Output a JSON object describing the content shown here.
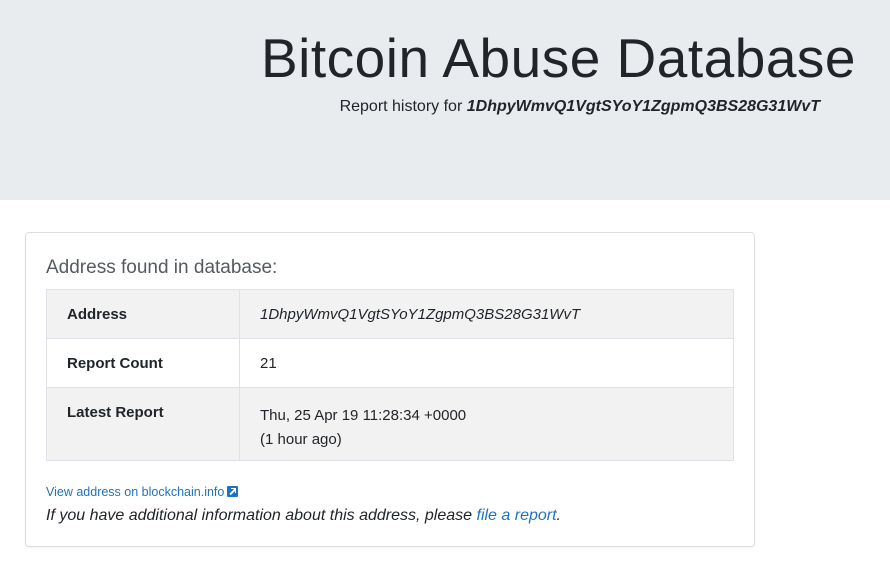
{
  "header": {
    "title": "Bitcoin Abuse Database",
    "subtitle_prefix": "Report history for",
    "address": "1DhpyWmvQ1VgtSYoY1ZgpmQ3BS28G31WvT"
  },
  "card": {
    "heading": "Address found in database:",
    "rows": [
      {
        "label": "Address",
        "value": "1DhpyWmvQ1VgtSYoY1ZgpmQ3BS28G31WvT"
      },
      {
        "label": "Report Count",
        "value": "21"
      },
      {
        "label": "Latest Report",
        "value": "Thu, 25 Apr 19 11:28:34 +0000",
        "value_sub": "(1 hour ago)"
      }
    ],
    "blockchain_link": "View address on blockchain.info",
    "external_icon": "external-link-icon",
    "note_prefix": "If you have additional information about this address, please",
    "note_link": "file a report",
    "note_suffix": "."
  },
  "colors": {
    "hero_bg": "#e9ecef",
    "link": "#1e73be",
    "stripe": "#f2f2f2"
  }
}
